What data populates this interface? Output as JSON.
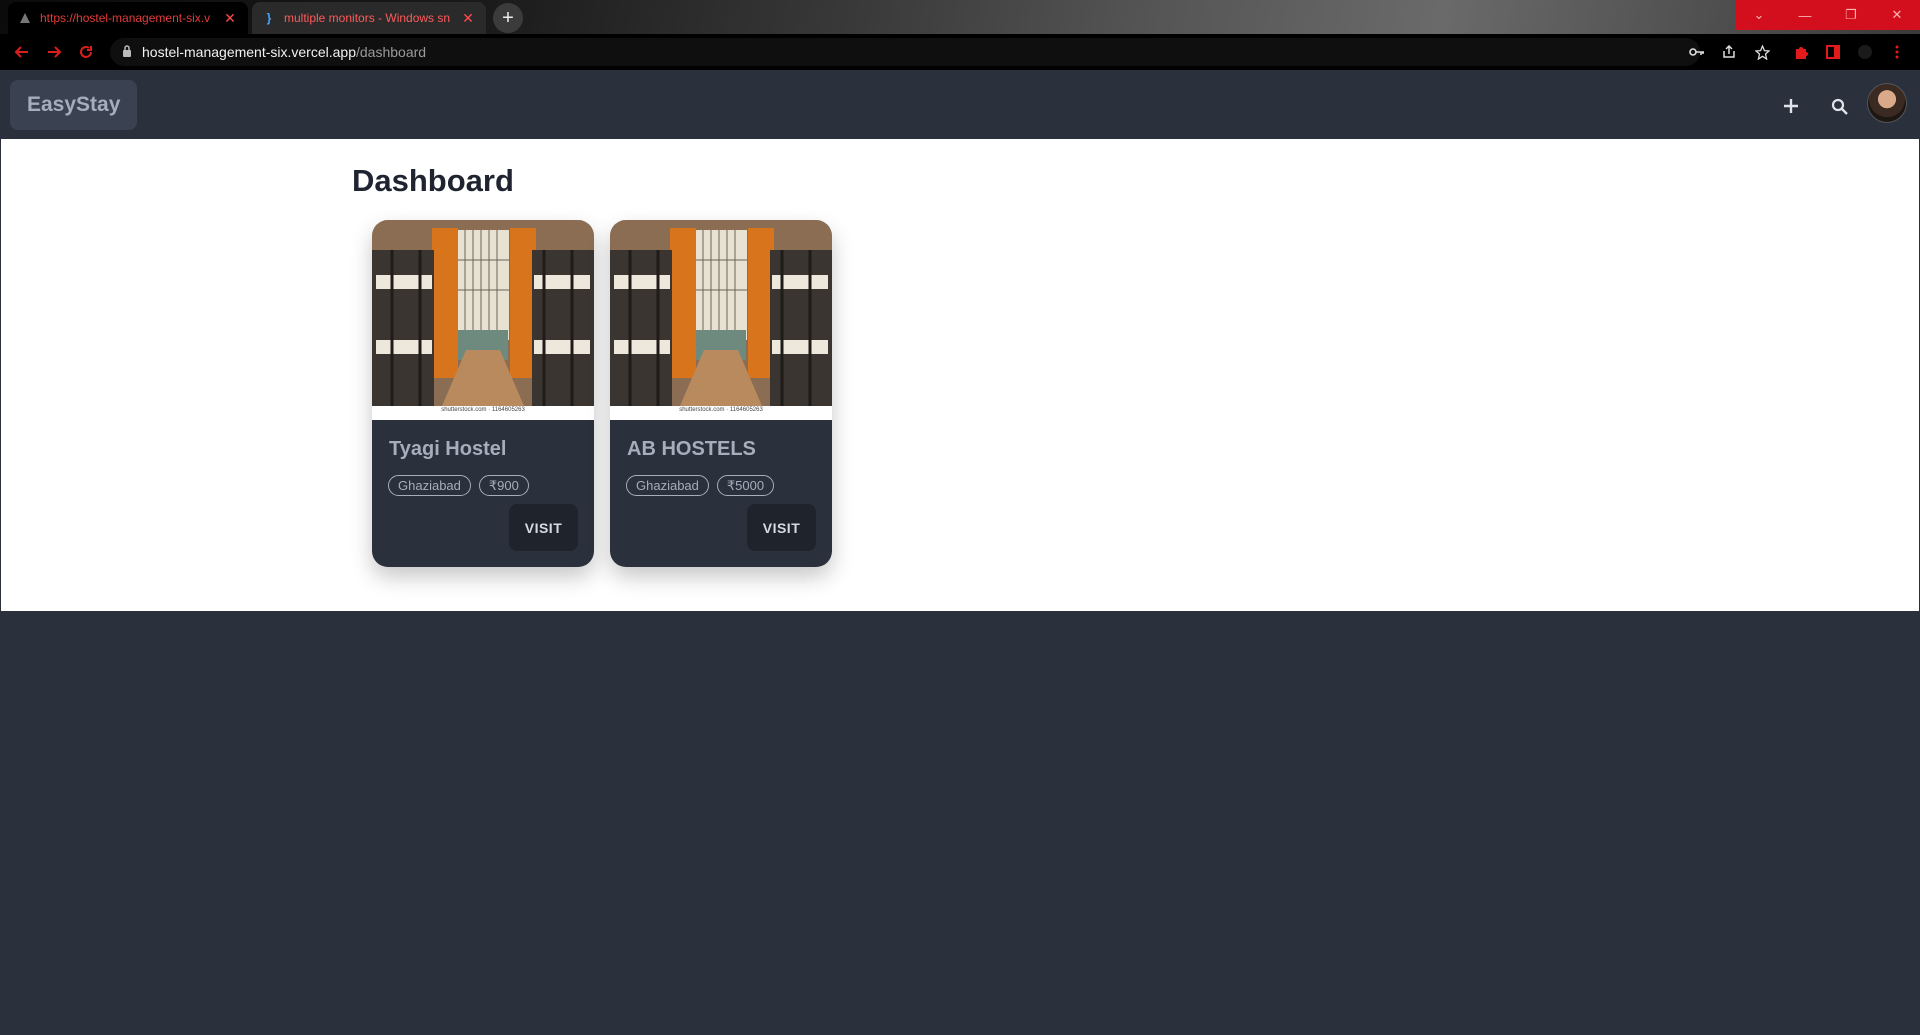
{
  "browser": {
    "tabs": [
      {
        "title": "https://hostel-management-six.v",
        "close": "✕"
      },
      {
        "title": "multiple monitors - Windows sn",
        "close": "✕"
      }
    ],
    "new_tab": "+",
    "window_buttons": [
      "⌄",
      "—",
      "❐",
      "✕"
    ],
    "url_host": "hostel-management-six.vercel.app",
    "url_path": "/dashboard",
    "accent": "#d40f1d"
  },
  "app": {
    "brand": "EasyStay",
    "page_title": "Dashboard",
    "image_caption": "shutterstock.com · 1164605263",
    "hostels": [
      {
        "name": "Tyagi Hostel",
        "city": "Ghaziabad",
        "price": "₹900",
        "action": "VISIT"
      },
      {
        "name": "AB HOSTELS",
        "city": "Ghaziabad",
        "price": "₹5000",
        "action": "VISIT"
      }
    ],
    "colors": {
      "nav": "#2a303c",
      "text_muted": "#a6adbb",
      "button": "#1e232c"
    }
  }
}
